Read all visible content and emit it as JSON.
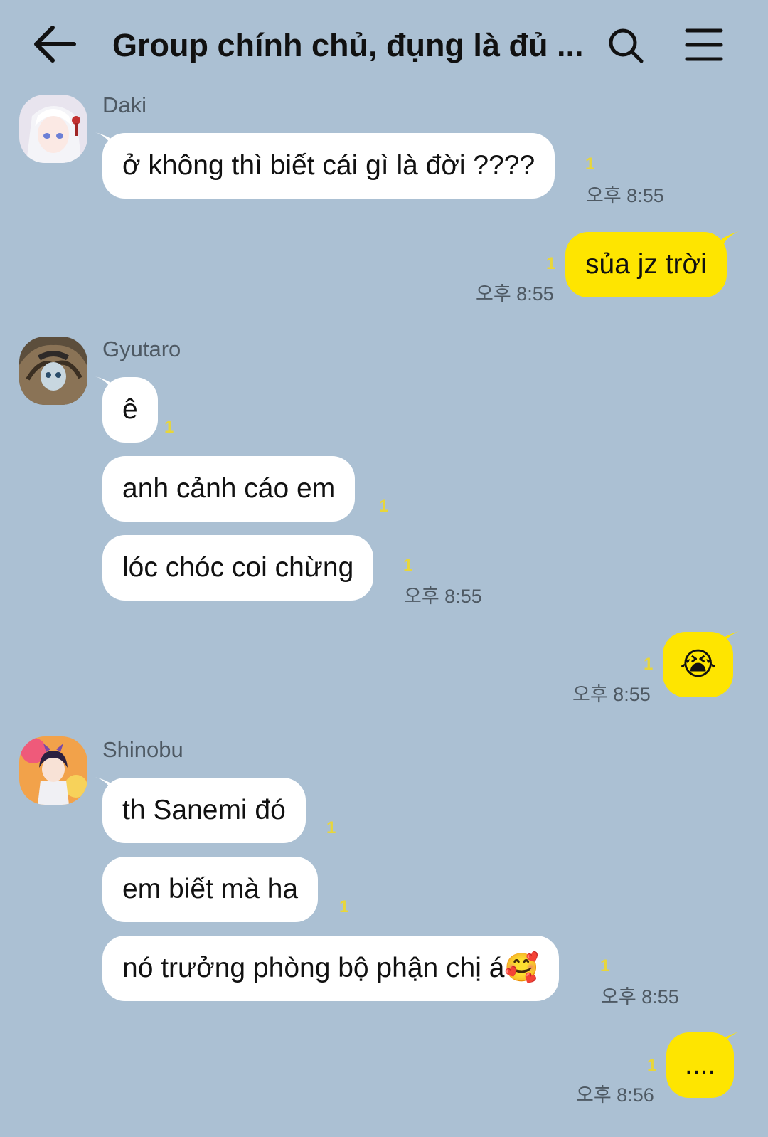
{
  "header": {
    "title": "Group chính chủ, đụng là đủ ..."
  },
  "messages": [
    {
      "sender": "Daki",
      "bubbles": [
        "ở không thì biết cái gì là đời ????"
      ],
      "unread": "1",
      "time": "오후 8:55"
    },
    {
      "sender": "me",
      "bubbles": [
        "sủa jz trời"
      ],
      "unread": "1",
      "time": "오후 8:55"
    },
    {
      "sender": "Gyutaro",
      "bubbles": [
        "ê",
        "anh cảnh cáo em",
        "lóc chóc coi chừng"
      ],
      "unread": "1",
      "time": "오후 8:55"
    },
    {
      "sender": "me",
      "bubbles": [
        "😭"
      ],
      "unread": "1",
      "time": "오후 8:55"
    },
    {
      "sender": "Shinobu",
      "bubbles": [
        "th Sanemi đó",
        "em biết mà ha",
        "nó trưởng phòng bộ phận chị á🥰"
      ],
      "unread": "1",
      "time": "오후 8:55"
    },
    {
      "sender": "me",
      "bubbles": [
        "...."
      ],
      "unread": "1",
      "time": "오후 8:56"
    }
  ],
  "icons": {
    "back": "arrow-left-icon",
    "search": "search-icon",
    "menu": "hamburger-menu-icon"
  },
  "colors": {
    "background": "#abc0d3",
    "incoming_bubble": "#ffffff",
    "outgoing_bubble": "#fee500",
    "unread_count": "#e8d63a"
  }
}
